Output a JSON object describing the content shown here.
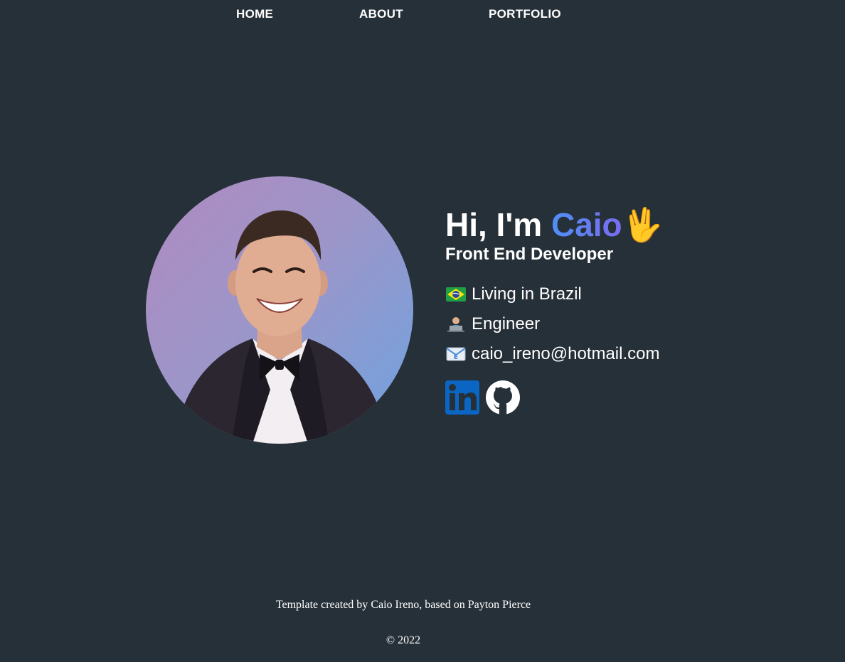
{
  "nav": {
    "items": [
      {
        "label": "HOME"
      },
      {
        "label": "ABOUT"
      },
      {
        "label": "PORTFOLIO"
      }
    ]
  },
  "intro": {
    "greeting_prefix": "Hi, I'm ",
    "name": "Caio",
    "wave": "🖖",
    "subtitle": "Front End Developer",
    "facts": [
      {
        "icon": "brazil-flag-icon",
        "text": "Living in Brazil"
      },
      {
        "icon": "technologist-icon",
        "text": "Engineer"
      },
      {
        "icon": "email-icon",
        "text": "caio_ireno@hotmail.com"
      }
    ]
  },
  "socials": [
    {
      "icon": "linkedin-icon",
      "color": "#0a66c2"
    },
    {
      "icon": "github-icon",
      "color": "#ffffff"
    }
  ],
  "footer": {
    "credit_prefix": "Template created by ",
    "credit_author": "Caio Ireno",
    "credit_middle": ", based on ",
    "credit_source": "Payton Pierce",
    "copyright": "© 2022"
  },
  "colors": {
    "background": "#263038",
    "text": "#ffffff",
    "name_gradient_start": "#4f8ff7",
    "name_gradient_end": "#7b6cf0"
  }
}
